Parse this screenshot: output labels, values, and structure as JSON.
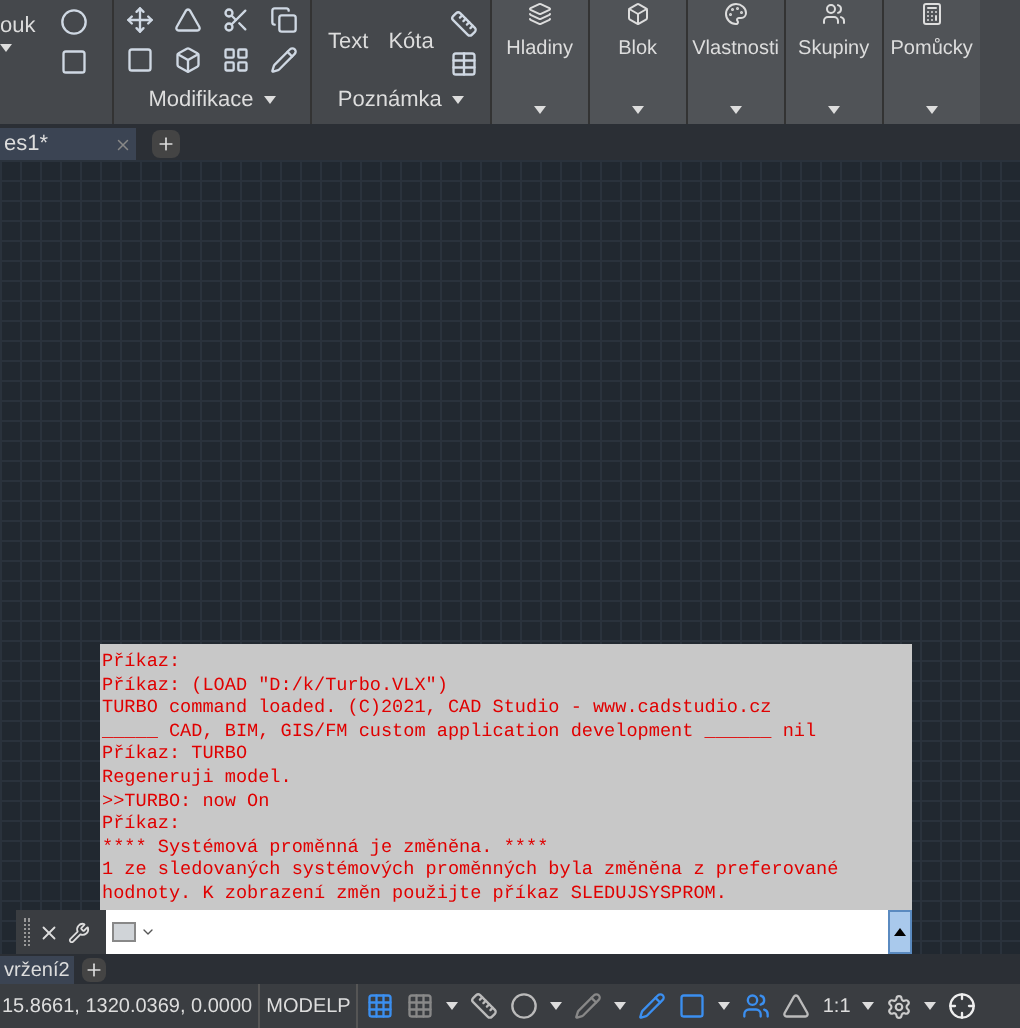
{
  "ribbon": {
    "partial_panel": {
      "label": "ouk"
    },
    "panels": [
      {
        "kind": "icons",
        "label": "Modifikace"
      },
      {
        "kind": "tools",
        "label": "Poznámka",
        "tools": [
          "Text",
          "Kóta"
        ]
      }
    ],
    "big_panels": [
      {
        "label": "Hladiny"
      },
      {
        "label": "Blok"
      },
      {
        "label": "Vlastnosti"
      },
      {
        "label": "Skupiny"
      },
      {
        "label": "Pomůcky"
      }
    ]
  },
  "file_tabs": [
    {
      "label": "es1*",
      "selected": true
    }
  ],
  "command_history": [
    "Příkaz:",
    "Příkaz: (LOAD \"D:/k/Turbo.VLX\")",
    "TURBO command loaded. (C)2021, CAD Studio - www.cadstudio.cz",
    "_____ CAD, BIM, GIS/FM custom application development ______ nil",
    "Příkaz: TURBO",
    "Regeneruji model.",
    ">>TURBO: now On",
    "Příkaz:",
    "**** Systémová proměnná je změněna. ****",
    "1 ze sledovaných systémových proměnných byla změněna z preferované",
    "hodnoty. K zobrazení změn použijte příkaz SLEDUJSYSPROM."
  ],
  "layout_tabs": [
    {
      "label": "vržení2",
      "selected": true
    }
  ],
  "status_bar": {
    "coordinates": "15.8661, 1320.0369, 0.0000",
    "mode": "MODELP",
    "scale": "1:1"
  }
}
